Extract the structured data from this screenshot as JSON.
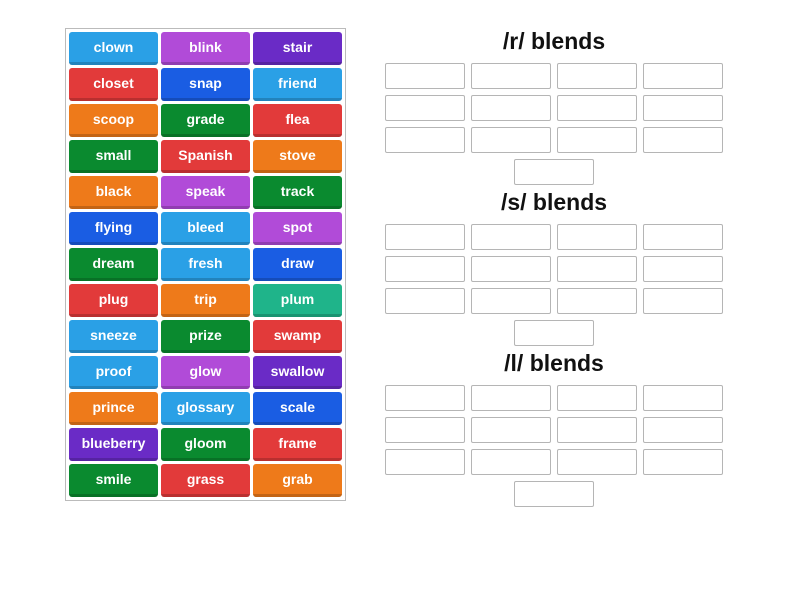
{
  "tiles": [
    {
      "label": "clown",
      "color": "#2aa0e6"
    },
    {
      "label": "blink",
      "color": "#b14bd8"
    },
    {
      "label": "stair",
      "color": "#6a2bc6"
    },
    {
      "label": "closet",
      "color": "#e23a3a"
    },
    {
      "label": "snap",
      "color": "#1a5de3"
    },
    {
      "label": "friend",
      "color": "#2aa0e6"
    },
    {
      "label": "scoop",
      "color": "#ee7a1a"
    },
    {
      "label": "grade",
      "color": "#0a8a2f"
    },
    {
      "label": "flea",
      "color": "#e23a3a"
    },
    {
      "label": "small",
      "color": "#0a8a2f"
    },
    {
      "label": "Spanish",
      "color": "#e23a3a"
    },
    {
      "label": "stove",
      "color": "#ee7a1a"
    },
    {
      "label": "black",
      "color": "#ee7a1a"
    },
    {
      "label": "speak",
      "color": "#b14bd8"
    },
    {
      "label": "track",
      "color": "#0a8a2f"
    },
    {
      "label": "flying",
      "color": "#1a5de3"
    },
    {
      "label": "bleed",
      "color": "#2aa0e6"
    },
    {
      "label": "spot",
      "color": "#b14bd8"
    },
    {
      "label": "dream",
      "color": "#0a8a2f"
    },
    {
      "label": "fresh",
      "color": "#2aa0e6"
    },
    {
      "label": "draw",
      "color": "#1a5de3"
    },
    {
      "label": "plug",
      "color": "#e23a3a"
    },
    {
      "label": "trip",
      "color": "#ee7a1a"
    },
    {
      "label": "plum",
      "color": "#1fb48a"
    },
    {
      "label": "sneeze",
      "color": "#2aa0e6"
    },
    {
      "label": "prize",
      "color": "#0a8a2f"
    },
    {
      "label": "swamp",
      "color": "#e23a3a"
    },
    {
      "label": "proof",
      "color": "#2aa0e6"
    },
    {
      "label": "glow",
      "color": "#b14bd8"
    },
    {
      "label": "swallow",
      "color": "#6a2bc6"
    },
    {
      "label": "prince",
      "color": "#ee7a1a"
    },
    {
      "label": "glossary",
      "color": "#2aa0e6"
    },
    {
      "label": "scale",
      "color": "#1a5de3"
    },
    {
      "label": "blueberry",
      "color": "#6a2bc6"
    },
    {
      "label": "gloom",
      "color": "#0a8a2f"
    },
    {
      "label": "frame",
      "color": "#e23a3a"
    },
    {
      "label": "smile",
      "color": "#0a8a2f"
    },
    {
      "label": "grass",
      "color": "#e23a3a"
    },
    {
      "label": "grab",
      "color": "#ee7a1a"
    }
  ],
  "groups": [
    {
      "title": "/r/ blends",
      "slot_count": 13
    },
    {
      "title": "/s/ blends",
      "slot_count": 13
    },
    {
      "title": "/l/ blends",
      "slot_count": 13
    }
  ]
}
